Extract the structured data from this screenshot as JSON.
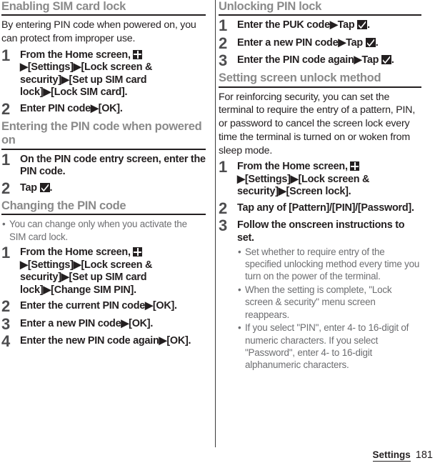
{
  "document": {
    "footer": {
      "section_label": "Settings",
      "page_number": "181"
    }
  },
  "left_column": {
    "section1": {
      "heading": "Enabling SIM card lock",
      "intro": "By entering PIN code when powered on, you can protect from improper use.",
      "steps": [
        {
          "number": "1",
          "text_before_icon": "From the Home screen, ",
          "icon": "apps-grid-icon",
          "text_after_icon": "▶[Settings]▶[Lock screen & security]▶[Set up SIM card lock]▶[Lock SIM card]."
        },
        {
          "number": "2",
          "text": "Enter PIN code▶[OK]."
        }
      ]
    },
    "section2": {
      "heading": "Entering the PIN code when powered on",
      "steps": [
        {
          "number": "1",
          "text": "On the PIN code entry screen, enter the PIN code."
        },
        {
          "number": "2",
          "text_before_icon": "Tap ",
          "icon": "checkmark-icon",
          "text_after_icon": "."
        }
      ]
    },
    "section3": {
      "heading": "Changing the PIN code",
      "notes": [
        "You can change only when you activate the SIM card lock."
      ],
      "steps": [
        {
          "number": "1",
          "text_before_icon": "From the Home screen, ",
          "icon": "apps-grid-icon",
          "text_after_icon": "▶[Settings]▶[Lock screen & security]▶[Set up SIM card lock]▶[Change SIM PIN]."
        },
        {
          "number": "2",
          "text": "Enter the current PIN code▶[OK]."
        },
        {
          "number": "3",
          "text": "Enter a new PIN code▶[OK]."
        },
        {
          "number": "4",
          "text": "Enter the new PIN code again▶[OK]."
        }
      ]
    }
  },
  "right_column": {
    "section1": {
      "heading": "Unlocking PIN lock",
      "steps": [
        {
          "number": "1",
          "text_before_icon": "Enter the PUK code▶Tap ",
          "icon": "checkmark-icon",
          "text_after_icon": "."
        },
        {
          "number": "2",
          "text_before_icon": "Enter a new PIN code▶Tap ",
          "icon": "checkmark-icon",
          "text_after_icon": "."
        },
        {
          "number": "3",
          "text_before_icon": "Enter the PIN code again▶Tap ",
          "icon": "checkmark-icon",
          "text_after_icon": "."
        }
      ]
    },
    "section2": {
      "heading": "Setting screen unlock method",
      "intro": "For reinforcing security, you can set the terminal to require the entry of a pattern, PIN, or password to cancel the screen lock every time the terminal is turned on or woken from sleep mode.",
      "steps": [
        {
          "number": "1",
          "text_before_icon": "From the Home screen, ",
          "icon": "apps-grid-icon",
          "text_after_icon": "▶[Settings]▶[Lock screen & security]▶[Screen lock]."
        },
        {
          "number": "2",
          "text": "Tap any of [Pattern]/[PIN]/[Password]."
        },
        {
          "number": "3",
          "text": "Follow the onscreen instructions to set.",
          "subnotes": [
            "Set whether to require entry of the specified unlocking method every time you turn on the power of the terminal.",
            "When the setting is complete, \"Lock screen & security\" menu screen reappears.",
            "If you select \"PIN\", enter 4- to 16-digit of numeric characters. If you select \"Password\", enter 4- to 16-digit alphanumeric characters."
          ]
        }
      ]
    }
  }
}
